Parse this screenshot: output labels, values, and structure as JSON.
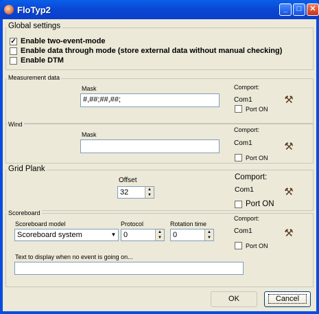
{
  "window": {
    "title": "FloTyp2",
    "minimize_glyph": "_",
    "maximize_glyph": "□",
    "close_glyph": "✕"
  },
  "global_settings": {
    "label": "Global settings",
    "options": [
      {
        "label": "Enable two-event-mode",
        "checked": true
      },
      {
        "label": "Enable data through mode (store external data without manual checking)",
        "checked": false
      },
      {
        "label": "Enable DTM",
        "checked": false
      }
    ]
  },
  "measurement": {
    "label": "Measurement data",
    "mask_label": "Mask",
    "mask_value": "#,##;##,##;",
    "comport_label": "Comport:",
    "comport_value": "Com1",
    "port_on_label": "Port ON",
    "port_on": false
  },
  "wind": {
    "label": "Wind",
    "mask_label": "Mask",
    "mask_value": "",
    "comport_label": "Comport:",
    "comport_value": "Com1",
    "port_on_label": "Port ON",
    "port_on": false
  },
  "grid_plank": {
    "label": "Grid Plank",
    "offset_label": "Offset",
    "offset_value": "32",
    "comport_label": "Comport:",
    "comport_value": "Com1",
    "port_on_label": "Port ON",
    "port_on": false
  },
  "scoreboard": {
    "label": "Scoreboard",
    "model_label": "Scoreboard model",
    "model_value": "Scoreboard system",
    "protocol_label": "Protocol",
    "protocol_value": "0",
    "rotation_label": "Rotation time",
    "rotation_value": "0",
    "comport_label": "Comport:",
    "comport_value": "Com1",
    "port_on_label": "Port ON",
    "port_on": false,
    "idle_text_label": "Text to display when no event is going on...",
    "idle_text_value": ""
  },
  "buttons": {
    "ok": "OK",
    "cancel": "Cancel"
  },
  "icons": {
    "settings_button": "wrench-hammer-icon",
    "app": "flower-icon"
  },
  "colors": {
    "titlebar": "#0a4ce0",
    "dialog": "#ece9d8",
    "close": "#c83018"
  }
}
